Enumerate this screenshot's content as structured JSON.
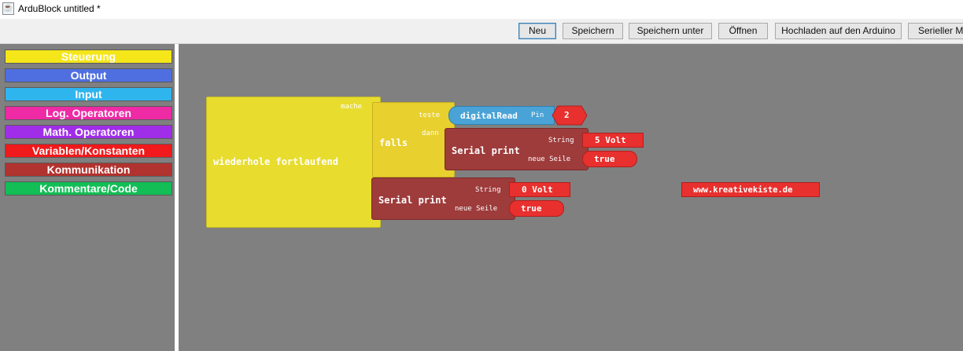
{
  "window": {
    "title": "ArduBlock untitled *"
  },
  "toolbar": {
    "buttons": [
      "Neu",
      "Speichern",
      "Speichern unter",
      "Öffnen",
      "Hochladen auf den Arduino",
      "Serieller Mon"
    ]
  },
  "palette": {
    "categories": [
      {
        "label": "Steuerung",
        "color": "#f5e61a"
      },
      {
        "label": "Output",
        "color": "#4f6fe0"
      },
      {
        "label": "Input",
        "color": "#2fb5ee"
      },
      {
        "label": "Log. Operatoren",
        "color": "#ee2aa5"
      },
      {
        "label": "Math. Operatoren",
        "color": "#a02ee8"
      },
      {
        "label": "Variablen/Konstanten",
        "color": "#f0191b"
      },
      {
        "label": "Kommunikation",
        "color": "#b1332f"
      },
      {
        "label": "Kommentare/Code",
        "color": "#12be55"
      }
    ]
  },
  "canvas": {
    "loop": {
      "label": "wiederhole fortlaufend",
      "slot_label": "mache"
    },
    "if_block": {
      "label": "falls",
      "test_label": "teste",
      "then_label": "dann"
    },
    "digital_read": {
      "label": "digitalRead",
      "pin_label": "Pin",
      "pin_value": "2"
    },
    "serial_print_1": {
      "label": "Serial print",
      "string_label": "String",
      "string_value": "5 Volt",
      "newline_label": "neue Seile",
      "newline_value": "true"
    },
    "serial_print_2": {
      "label": "Serial print",
      "string_label": "String",
      "string_value": "0 Volt",
      "newline_label": "neue Seile",
      "newline_value": "true"
    },
    "loose_string": {
      "value": "www.kreativekiste.de"
    }
  },
  "colors": {
    "control": "#e8dc2e",
    "communication": "#9e3b3b",
    "input": "#4aa3d6",
    "variable": "#e8302e"
  }
}
